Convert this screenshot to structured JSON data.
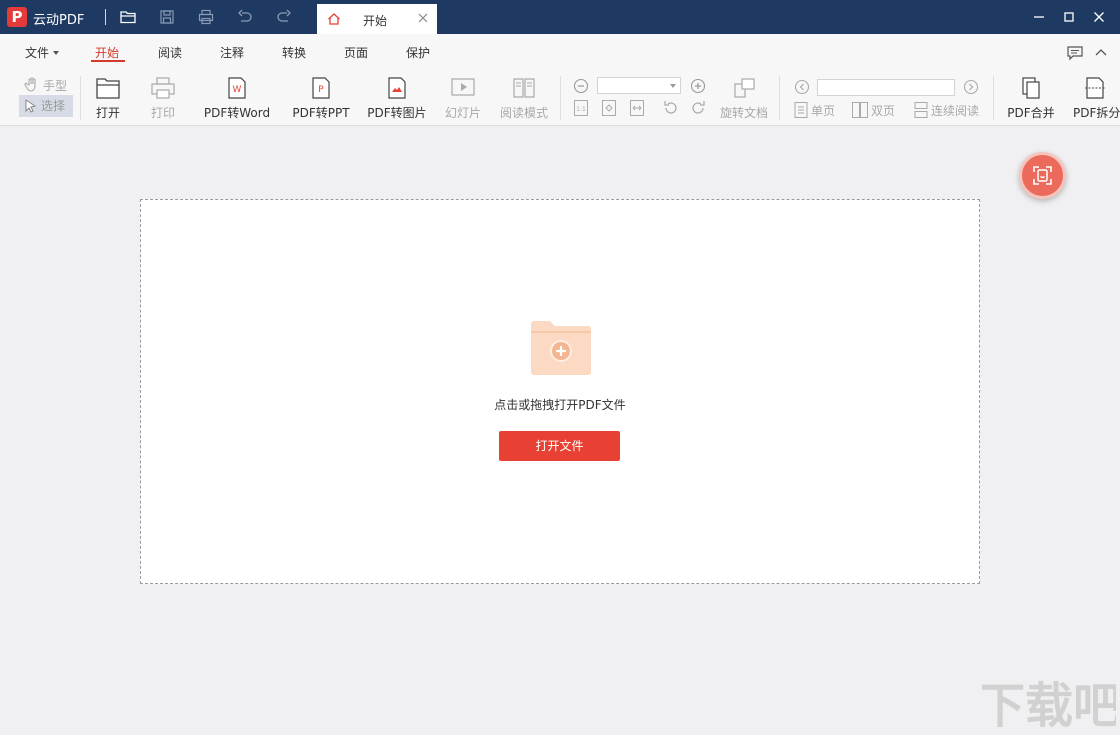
{
  "app": {
    "logo_letter": "P",
    "title": "云动PDF"
  },
  "document_tab": {
    "label": "开始"
  },
  "menu": {
    "file": "文件",
    "items": [
      "开始",
      "阅读",
      "注释",
      "转换",
      "页面",
      "保护"
    ],
    "active": "开始"
  },
  "toolbar": {
    "hand": "手型",
    "select": "选择",
    "open": "打开",
    "print": "打印",
    "pdf_to_word": "PDF转Word",
    "pdf_to_ppt": "PDF转PPT",
    "pdf_to_image": "PDF转图片",
    "slideshow": "幻灯片",
    "read_mode": "阅读模式",
    "rotate_doc": "旋转文档",
    "single_page": "单页",
    "double_page": "双页",
    "continuous": "连续阅读",
    "pdf_merge": "PDF合并",
    "pdf_split": "PDF拆分",
    "zoom_value": "",
    "page_value": ""
  },
  "drop_zone": {
    "hint": "点击或拖拽打开PDF文件",
    "open_button": "打开文件"
  },
  "colors": {
    "titlebar": "#1e3a63",
    "accent": "#e84134",
    "folder": "#fcd9c2",
    "float_button": "#ec6a5c"
  },
  "watermark": {
    "text": "下载吧"
  }
}
